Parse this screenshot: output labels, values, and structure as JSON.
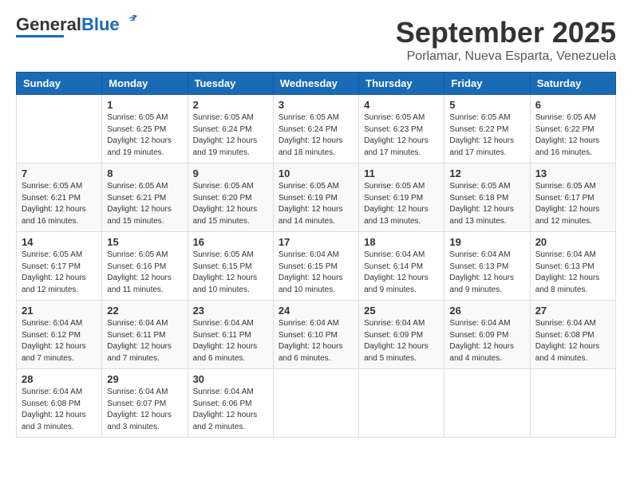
{
  "logo": {
    "general": "General",
    "blue": "Blue"
  },
  "title": "September 2025",
  "subtitle": "Porlamar, Nueva Esparta, Venezuela",
  "days_of_week": [
    "Sunday",
    "Monday",
    "Tuesday",
    "Wednesday",
    "Thursday",
    "Friday",
    "Saturday"
  ],
  "weeks": [
    [
      {
        "day": "",
        "info": ""
      },
      {
        "day": "1",
        "info": "Sunrise: 6:05 AM\nSunset: 6:25 PM\nDaylight: 12 hours\nand 19 minutes."
      },
      {
        "day": "2",
        "info": "Sunrise: 6:05 AM\nSunset: 6:24 PM\nDaylight: 12 hours\nand 19 minutes."
      },
      {
        "day": "3",
        "info": "Sunrise: 6:05 AM\nSunset: 6:24 PM\nDaylight: 12 hours\nand 18 minutes."
      },
      {
        "day": "4",
        "info": "Sunrise: 6:05 AM\nSunset: 6:23 PM\nDaylight: 12 hours\nand 17 minutes."
      },
      {
        "day": "5",
        "info": "Sunrise: 6:05 AM\nSunset: 6:22 PM\nDaylight: 12 hours\nand 17 minutes."
      },
      {
        "day": "6",
        "info": "Sunrise: 6:05 AM\nSunset: 6:22 PM\nDaylight: 12 hours\nand 16 minutes."
      }
    ],
    [
      {
        "day": "7",
        "info": "Sunrise: 6:05 AM\nSunset: 6:21 PM\nDaylight: 12 hours\nand 16 minutes."
      },
      {
        "day": "8",
        "info": "Sunrise: 6:05 AM\nSunset: 6:21 PM\nDaylight: 12 hours\nand 15 minutes."
      },
      {
        "day": "9",
        "info": "Sunrise: 6:05 AM\nSunset: 6:20 PM\nDaylight: 12 hours\nand 15 minutes."
      },
      {
        "day": "10",
        "info": "Sunrise: 6:05 AM\nSunset: 6:19 PM\nDaylight: 12 hours\nand 14 minutes."
      },
      {
        "day": "11",
        "info": "Sunrise: 6:05 AM\nSunset: 6:19 PM\nDaylight: 12 hours\nand 13 minutes."
      },
      {
        "day": "12",
        "info": "Sunrise: 6:05 AM\nSunset: 6:18 PM\nDaylight: 12 hours\nand 13 minutes."
      },
      {
        "day": "13",
        "info": "Sunrise: 6:05 AM\nSunset: 6:17 PM\nDaylight: 12 hours\nand 12 minutes."
      }
    ],
    [
      {
        "day": "14",
        "info": "Sunrise: 6:05 AM\nSunset: 6:17 PM\nDaylight: 12 hours\nand 12 minutes."
      },
      {
        "day": "15",
        "info": "Sunrise: 6:05 AM\nSunset: 6:16 PM\nDaylight: 12 hours\nand 11 minutes."
      },
      {
        "day": "16",
        "info": "Sunrise: 6:05 AM\nSunset: 6:15 PM\nDaylight: 12 hours\nand 10 minutes."
      },
      {
        "day": "17",
        "info": "Sunrise: 6:04 AM\nSunset: 6:15 PM\nDaylight: 12 hours\nand 10 minutes."
      },
      {
        "day": "18",
        "info": "Sunrise: 6:04 AM\nSunset: 6:14 PM\nDaylight: 12 hours\nand 9 minutes."
      },
      {
        "day": "19",
        "info": "Sunrise: 6:04 AM\nSunset: 6:13 PM\nDaylight: 12 hours\nand 9 minutes."
      },
      {
        "day": "20",
        "info": "Sunrise: 6:04 AM\nSunset: 6:13 PM\nDaylight: 12 hours\nand 8 minutes."
      }
    ],
    [
      {
        "day": "21",
        "info": "Sunrise: 6:04 AM\nSunset: 6:12 PM\nDaylight: 12 hours\nand 7 minutes."
      },
      {
        "day": "22",
        "info": "Sunrise: 6:04 AM\nSunset: 6:11 PM\nDaylight: 12 hours\nand 7 minutes."
      },
      {
        "day": "23",
        "info": "Sunrise: 6:04 AM\nSunset: 6:11 PM\nDaylight: 12 hours\nand 6 minutes."
      },
      {
        "day": "24",
        "info": "Sunrise: 6:04 AM\nSunset: 6:10 PM\nDaylight: 12 hours\nand 6 minutes."
      },
      {
        "day": "25",
        "info": "Sunrise: 6:04 AM\nSunset: 6:09 PM\nDaylight: 12 hours\nand 5 minutes."
      },
      {
        "day": "26",
        "info": "Sunrise: 6:04 AM\nSunset: 6:09 PM\nDaylight: 12 hours\nand 4 minutes."
      },
      {
        "day": "27",
        "info": "Sunrise: 6:04 AM\nSunset: 6:08 PM\nDaylight: 12 hours\nand 4 minutes."
      }
    ],
    [
      {
        "day": "28",
        "info": "Sunrise: 6:04 AM\nSunset: 6:08 PM\nDaylight: 12 hours\nand 3 minutes."
      },
      {
        "day": "29",
        "info": "Sunrise: 6:04 AM\nSunset: 6:07 PM\nDaylight: 12 hours\nand 3 minutes."
      },
      {
        "day": "30",
        "info": "Sunrise: 6:04 AM\nSunset: 6:06 PM\nDaylight: 12 hours\nand 2 minutes."
      },
      {
        "day": "",
        "info": ""
      },
      {
        "day": "",
        "info": ""
      },
      {
        "day": "",
        "info": ""
      },
      {
        "day": "",
        "info": ""
      }
    ]
  ]
}
